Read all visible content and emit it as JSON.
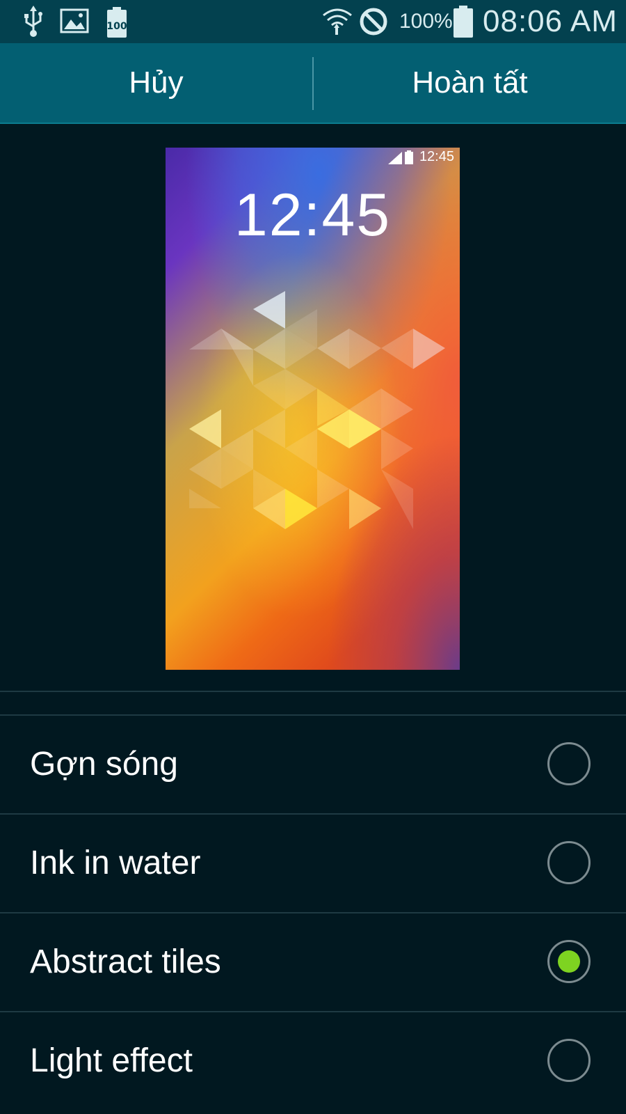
{
  "status_bar": {
    "icons": [
      "usb-icon",
      "image-icon",
      "battery-saver-icon",
      "wifi-icon",
      "no-disturb-icon",
      "battery-icon"
    ],
    "battery_saver_label": "100",
    "battery_percent": "100%",
    "time": "08:06 AM"
  },
  "action_bar": {
    "cancel_label": "Hủy",
    "done_label": "Hoàn tất"
  },
  "preview": {
    "status_time": "12:45",
    "clock": "12:45"
  },
  "options": [
    {
      "label": "Gợn sóng",
      "selected": false
    },
    {
      "label": "Ink in water",
      "selected": false
    },
    {
      "label": "Abstract tiles",
      "selected": true
    },
    {
      "label": "Light effect",
      "selected": false
    }
  ],
  "colors": {
    "status_bar_bg": "#03414f",
    "action_bar_bg": "#035f72",
    "page_bg": "#011820",
    "radio_selected": "#7ed321"
  }
}
